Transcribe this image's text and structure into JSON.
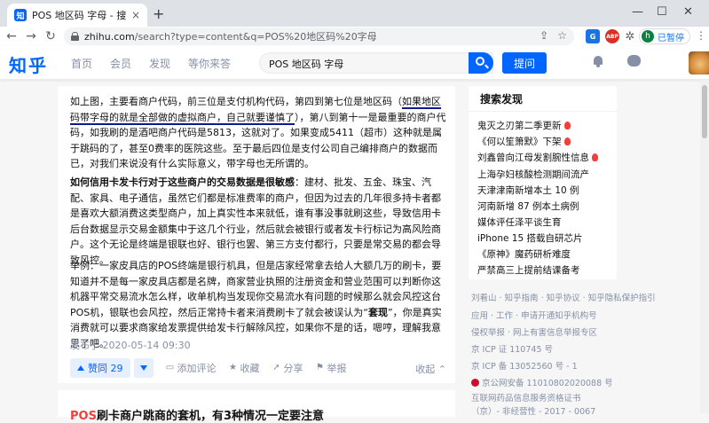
{
  "browser": {
    "tab_title": "POS 地区码 字母 - 搜索结果 - 知",
    "tab_favicon": "知",
    "tab_close": "×",
    "new_tab": "+",
    "minimize": "—",
    "maximize": "☐",
    "close": "✕",
    "url_host": "zhihu.com",
    "url_rest": "/search?type=content&q=POS%20地区码%20字母",
    "ext_translate": "G",
    "ext_abp": "ABP",
    "profile_initial": "h",
    "profile_label": "已暂停"
  },
  "header": {
    "logo": "知乎",
    "nav": [
      "首页",
      "会员",
      "发现",
      "等你来答"
    ],
    "search_value": "POS 地区码 字母",
    "ask_label": "提问"
  },
  "answer": {
    "p1_pre": "如上图，主要看商户代码，前三位是支付机构代码，第四到第七位是地区码（",
    "p1_highlight": "如果地区码带字母的就是全部做的虚拟商户，自己就要谨慎了",
    "p1_post": "），第八到第十一是最重要的商户代码，如我刷的是酒吧商户代码是5813，这就对了。如果变成5411（超市）这种就是属于跳码的了，甚至0费率的医院这些。至于最后四位是支付公司自己编排商户的数据而已，对我们来说没有什么实际意义，带字母也无所谓的。",
    "p2_bold": "如何信用卡发卡行对于这些商户的交易数据是很敏感",
    "p2_rest": "：建材、批发、五金、珠宝、汽配、家具、电子通信，虽然它们都是标准费率的商户，但因为过去的几年很多持卡者都是喜欢大额消费这类型商户，加上真实性本来就低，谁有事没事就刷这些，导致信用卡后台数据显示交易金额集中于这几个行业，然后就会被银行或者发卡行标记为高风险商户。这个无论是终端是银联也好、银行也罢、第三方支付都行，只要是常交易的都会导致风控。",
    "p3_pre": "举例：一家皮具店的POS终端是银行机具，但是店家经常拿去给人大额几万的刷卡，要知道并不是每一家皮具店都是名牌，商家营业执照的注册资金和营业范围可以判断你这机器平常交易流水怎么样，收单机构当发现你交易流水有问题的时候那么就会风控这台POS机，银联也会风控，然后正常持卡者来消费刷卡了就会被误认为“",
    "p3_bold": "套现",
    "p3_post": "”，你是真实消费就可以要求商家给发票提供给发卡行解除风控，如果你不是的话，嗯哼，理解我意思了吧。",
    "publish_time": "发布于 2020-05-14 09:30",
    "vote_label": "赞同 29",
    "comment_label": "添加评论",
    "fav_label": "收藏",
    "share_label": "分享",
    "report_label": "举报",
    "collapse_label": "收起 ⌃"
  },
  "next_result": {
    "title_highlight": "POS",
    "title_rest": "刷卡商户跳商的套机，有3种情况一定要注意"
  },
  "sidebar": {
    "title": "搜索发现",
    "items": [
      {
        "label": "鬼灭之刃第二季更新",
        "hot": true
      },
      {
        "label": "《何以笙箫默》下架",
        "hot": true
      },
      {
        "label": "刘鑫曾向江母发割腕性信息",
        "hot": true
      },
      {
        "label": "上海孕妇核酸检测期间流产",
        "hot": false
      },
      {
        "label": "天津津南新增本土 10 例",
        "hot": false
      },
      {
        "label": "河南新增 87 例本土病例",
        "hot": false
      },
      {
        "label": "媒体评任泽平谈生育",
        "hot": false
      },
      {
        "label": "iPhone 15 搭载自研芯片",
        "hot": false
      },
      {
        "label": "《原神》魔药研析难度",
        "hot": false
      },
      {
        "label": "严禁高三上提前结课备考",
        "hot": false
      }
    ]
  },
  "footer": {
    "line1": "刘看山 · 知乎指南 · 知乎协议 · 知乎隐私保护指引",
    "line2": "应用 · 工作 · 申请开通知乎机构号",
    "line3": "侵权举报 · 网上有害信息举报专区",
    "line4": "京 ICP 证 110745 号",
    "line5": "京 ICP 备 13052560 号 - 1",
    "line6": "京公网安备 11010802020088 号",
    "line7": "互联网药品信息服务资格证书",
    "line8": "（京）- 非经营性 - 2017 - 0067"
  }
}
